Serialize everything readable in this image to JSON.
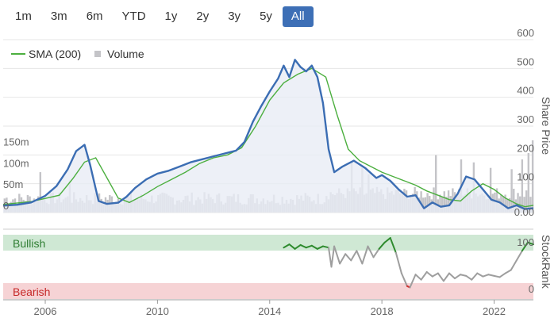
{
  "range_buttons": [
    {
      "label": "1m",
      "active": false
    },
    {
      "label": "3m",
      "active": false
    },
    {
      "label": "6m",
      "active": false
    },
    {
      "label": "YTD",
      "active": false
    },
    {
      "label": "1y",
      "active": false
    },
    {
      "label": "2y",
      "active": false
    },
    {
      "label": "3y",
      "active": false
    },
    {
      "label": "5y",
      "active": false
    },
    {
      "label": "All",
      "active": true
    }
  ],
  "legend": {
    "sma_label": "SMA (200)",
    "volume_label": "Volume"
  },
  "colors": {
    "price": "#3b6db3",
    "sma": "#4caf3f",
    "volume": "#c4c4c8",
    "bullish_band": "#cfe8d4",
    "bearish_band": "#f6d3d5",
    "bullish_text": "#2e7d32",
    "bearish_text": "#c62828",
    "stockrank_mid": "#9e9e9e",
    "stockrank_bull": "#2e8b2e",
    "stockrank_bear": "#d32f2f",
    "active_button": "#3d6fb6"
  },
  "chart_data": [
    {
      "type": "line",
      "title": "",
      "right_axis_title": "Share Price",
      "right_ticks": [
        "600",
        "500",
        "400",
        "300",
        "200",
        "100",
        "0.00"
      ],
      "left_axis_title": "",
      "left_ticks": [
        "150m",
        "100m",
        "50m",
        "0"
      ],
      "x_ticks": [
        "2006",
        "2010",
        "2014",
        "2018",
        "2022"
      ],
      "x_range": [
        2004.5,
        2023.4
      ],
      "price_range": [
        0,
        600
      ],
      "volume_range": [
        0,
        250
      ],
      "series": [
        {
          "name": "Price",
          "axis": "right",
          "x": [
            2004.5,
            2005.0,
            2005.5,
            2006.0,
            2006.4,
            2006.8,
            2007.1,
            2007.4,
            2007.6,
            2007.9,
            2008.2,
            2008.6,
            2008.9,
            2009.2,
            2009.6,
            2010.0,
            2010.4,
            2010.8,
            2011.2,
            2011.6,
            2012.0,
            2012.4,
            2012.8,
            2013.1,
            2013.4,
            2013.7,
            2014.0,
            2014.3,
            2014.5,
            2014.7,
            2014.9,
            2015.1,
            2015.3,
            2015.5,
            2015.7,
            2015.9,
            2016.1,
            2016.3,
            2016.6,
            2017.0,
            2017.4,
            2017.8,
            2018.0,
            2018.3,
            2018.6,
            2018.9,
            2019.2,
            2019.5,
            2019.8,
            2020.1,
            2020.4,
            2020.7,
            2021.0,
            2021.3,
            2021.6,
            2021.9,
            2022.2,
            2022.5,
            2022.8,
            2023.1,
            2023.4
          ],
          "y": [
            24,
            27,
            35,
            58,
            92,
            150,
            213,
            235,
            165,
            40,
            30,
            34,
            55,
            85,
            115,
            135,
            145,
            160,
            175,
            185,
            195,
            205,
            215,
            245,
            315,
            370,
            420,
            465,
            510,
            470,
            530,
            505,
            490,
            510,
            470,
            380,
            220,
            140,
            160,
            180,
            155,
            120,
            130,
            110,
            80,
            55,
            60,
            15,
            35,
            20,
            25,
            65,
            125,
            115,
            80,
            45,
            35,
            15,
            25,
            12,
            15
          ]
        },
        {
          "name": "SMA (200)",
          "axis": "right",
          "x": [
            2004.5,
            2005.5,
            2006.5,
            2007.0,
            2007.4,
            2007.8,
            2008.2,
            2008.6,
            2009.0,
            2009.5,
            2010.0,
            2010.5,
            2011.0,
            2011.5,
            2012.0,
            2012.5,
            2013.0,
            2013.5,
            2014.0,
            2014.5,
            2015.0,
            2015.5,
            2016.0,
            2016.4,
            2016.8,
            2017.2,
            2017.6,
            2018.0,
            2018.4,
            2018.8,
            2019.2,
            2019.6,
            2020.0,
            2020.4,
            2020.8,
            2021.2,
            2021.6,
            2022.0,
            2022.4,
            2022.8,
            2023.1,
            2023.4
          ],
          "y": [
            28,
            38,
            60,
            120,
            175,
            190,
            120,
            50,
            35,
            60,
            90,
            115,
            140,
            170,
            190,
            200,
            225,
            300,
            390,
            450,
            480,
            500,
            470,
            340,
            220,
            180,
            160,
            140,
            125,
            110,
            95,
            75,
            60,
            45,
            40,
            75,
            100,
            80,
            50,
            30,
            20,
            25
          ]
        },
        {
          "name": "Volume",
          "axis": "left",
          "type": "bar",
          "x": [],
          "y": []
        }
      ]
    },
    {
      "type": "line",
      "title": "",
      "right_axis_title": "StockRank",
      "right_ticks": [
        "100",
        "0"
      ],
      "bands": [
        {
          "label": "Bullish",
          "range": [
            70,
            100
          ]
        },
        {
          "label": "Bearish",
          "range": [
            0,
            30
          ]
        }
      ],
      "y_range": [
        0,
        100
      ],
      "series": [
        {
          "name": "StockRank",
          "x": [
            2014.5,
            2014.7,
            2014.9,
            2015.1,
            2015.3,
            2015.5,
            2015.7,
            2015.9,
            2016.1,
            2016.2,
            2016.3,
            2016.5,
            2016.7,
            2016.9,
            2017.1,
            2017.3,
            2017.5,
            2017.7,
            2017.9,
            2018.1,
            2018.3,
            2018.5,
            2018.7,
            2018.9,
            2019.0,
            2019.2,
            2019.4,
            2019.6,
            2019.8,
            2020.0,
            2020.2,
            2020.4,
            2020.6,
            2020.8,
            2021.0,
            2021.2,
            2021.4,
            2021.6,
            2021.8,
            2022.0,
            2022.2,
            2022.4,
            2022.6,
            2022.8,
            2023.0,
            2023.2,
            2023.4
          ],
          "y": [
            80,
            85,
            78,
            84,
            80,
            83,
            78,
            82,
            80,
            50,
            82,
            55,
            70,
            60,
            75,
            55,
            82,
            65,
            78,
            88,
            95,
            72,
            40,
            20,
            18,
            38,
            30,
            42,
            35,
            40,
            28,
            40,
            32,
            38,
            36,
            30,
            40,
            35,
            38,
            36,
            34,
            40,
            45,
            60,
            75,
            88,
            85
          ]
        }
      ]
    }
  ]
}
